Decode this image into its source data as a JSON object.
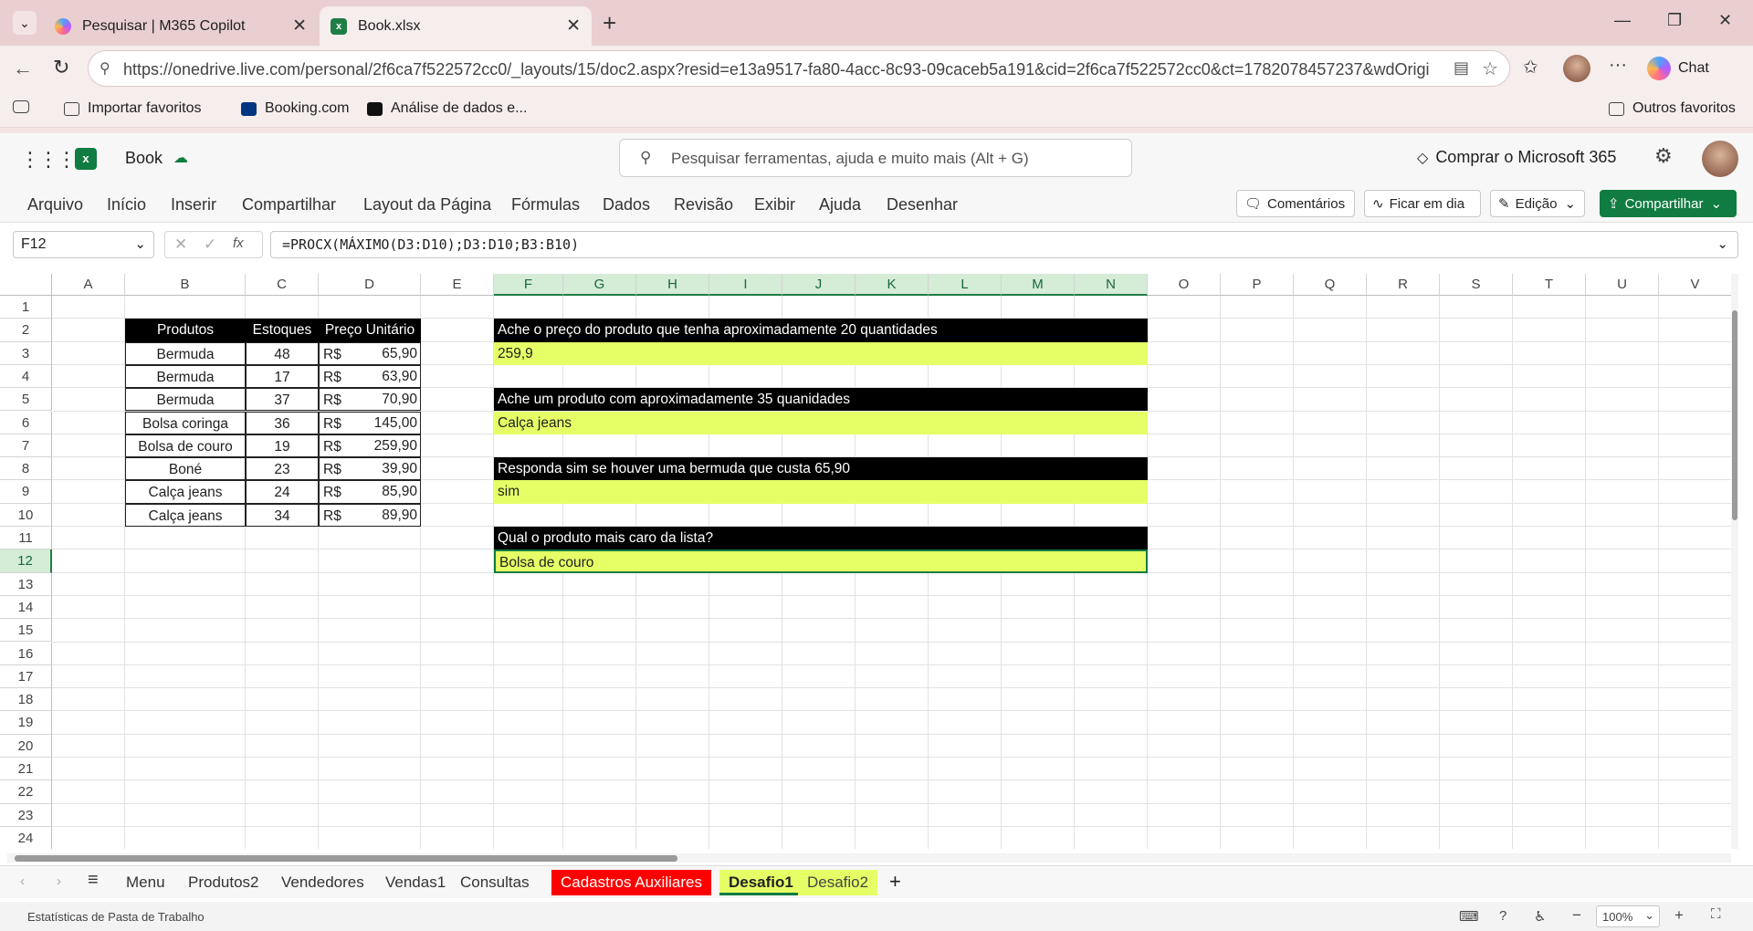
{
  "browser": {
    "tabs": [
      {
        "title": "Pesquisar | M365 Copilot",
        "active": false
      },
      {
        "title": "Book.xlsx",
        "active": true
      }
    ],
    "url": "https://onedrive.live.com/personal/2f6ca7f522572cc0/_layouts/15/doc2.aspx?resid=e13a9517-fa80-4acc-8c93-09caceb5a191&cid=2f6ca7f522572cc0&ct=1782078457237&wdOrigin=O...",
    "chat_label": "Chat",
    "favorites": [
      "Importar favoritos",
      "Booking.com",
      "Análise de dados e..."
    ],
    "other_favorites": "Outros favoritos"
  },
  "app": {
    "doc_name": "Book",
    "search_placeholder": "Pesquisar ferramentas, ajuda e muito mais (Alt + G)",
    "buy_label": "Comprar o Microsoft 365",
    "menu": [
      "Arquivo",
      "Início",
      "Inserir",
      "Compartilhar",
      "Layout da Página",
      "Fórmulas",
      "Dados",
      "Revisão",
      "Exibir",
      "Ajuda",
      "Desenhar"
    ],
    "comments_label": "Comentários",
    "catchup_label": "Ficar em dia",
    "editing_label": "Edição",
    "share_label": "Compartilhar",
    "accent": "#107c41"
  },
  "formula": {
    "name_box": "F12",
    "formula": "=PROCX(MÁXIMO(D3:D10);D3:D10;B3:B10)"
  },
  "sheet": {
    "columns": [
      "A",
      "B",
      "C",
      "D",
      "E",
      "F",
      "G",
      "H",
      "I",
      "J",
      "K",
      "L",
      "M",
      "N",
      "O",
      "P",
      "Q",
      "R",
      "S",
      "T",
      "U",
      "V"
    ],
    "rows": [
      "1",
      "2",
      "3",
      "4",
      "5",
      "6",
      "7",
      "8",
      "9",
      "10",
      "11",
      "12",
      "13",
      "14",
      "15",
      "16",
      "17",
      "18",
      "19",
      "20",
      "21",
      "22",
      "23",
      "24"
    ],
    "selected_column": "F",
    "selected_row": "12",
    "table": {
      "headers": [
        "Produtos",
        "Estoques",
        "Preço Unitário"
      ],
      "rows": [
        [
          "Bermuda",
          "48",
          "R$",
          "65,90"
        ],
        [
          "Bermuda",
          "17",
          "R$",
          "63,90"
        ],
        [
          "Bermuda",
          "37",
          "R$",
          "70,90"
        ],
        [
          "Bolsa coringa",
          "36",
          "R$",
          "145,00"
        ],
        [
          "Bolsa de couro",
          "19",
          "R$",
          "259,90"
        ],
        [
          "Boné",
          "23",
          "R$",
          "39,90"
        ],
        [
          "Calça jeans",
          "24",
          "R$",
          "85,90"
        ],
        [
          "Calça jeans",
          "34",
          "R$",
          "89,90"
        ]
      ]
    },
    "questions": [
      {
        "question": "Ache o preço do produto que tenha aproximadamente 20 quantidades",
        "answer": "259,9"
      },
      {
        "question": "Ache um produto com aproximadamente 35 quanidades",
        "answer": "Calça jeans"
      },
      {
        "question": "Responda sim se houver uma bermuda que custa 65,90",
        "answer": "sim"
      },
      {
        "question": "Qual o produto mais caro da lista?",
        "answer": "Bolsa de couro"
      }
    ],
    "header_bg": "#000000",
    "answer_bg": "#e6ff66"
  },
  "sheet_tabs": [
    {
      "name": "Menu",
      "style": "normal"
    },
    {
      "name": "Produtos2",
      "style": "normal"
    },
    {
      "name": "Vendedores",
      "style": "normal"
    },
    {
      "name": "Vendas1",
      "style": "normal"
    },
    {
      "name": "Consultas",
      "style": "normal"
    },
    {
      "name": "Cadastros Auxiliares",
      "style": "red"
    },
    {
      "name": "Desafio1",
      "style": "active-yellow"
    },
    {
      "name": "Desafio2",
      "style": "yellow"
    }
  ],
  "status": {
    "left": "Estatísticas de Pasta de Trabalho",
    "zoom": "100%"
  }
}
